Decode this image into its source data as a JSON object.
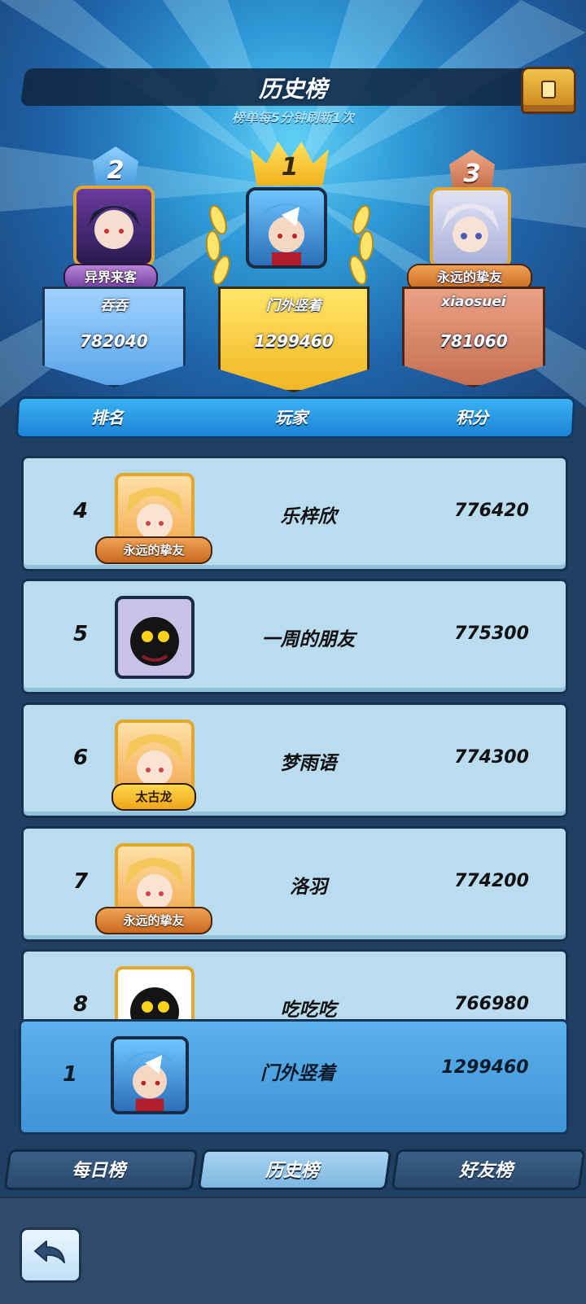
{
  "header": {
    "title": "历史榜",
    "subtitle": "榜单每5分钟刷新1次"
  },
  "podium": [
    {
      "rank": "1",
      "badge_title": "",
      "name": "门外竖着",
      "score": "1299460"
    },
    {
      "rank": "2",
      "badge_title": "异界来客",
      "name": "吞吞",
      "score": "782040"
    },
    {
      "rank": "3",
      "badge_title": "永远的挚友",
      "name": "xiaosuei",
      "score": "781060"
    }
  ],
  "table": {
    "columns": [
      "排名",
      "玩家",
      "积分"
    ],
    "rows": [
      {
        "rank": "4",
        "name": "乐梓欣",
        "score": "776420",
        "tag": "永远的挚友"
      },
      {
        "rank": "5",
        "name": "一周的朋友",
        "score": "775300",
        "tag": ""
      },
      {
        "rank": "6",
        "name": "梦雨语",
        "score": "774300",
        "tag": "太古龙"
      },
      {
        "rank": "7",
        "name": "洛羽",
        "score": "774200",
        "tag": "永远的挚友"
      },
      {
        "rank": "8",
        "name": "吃吃吃",
        "score": "766980",
        "tag": ""
      }
    ]
  },
  "self_row": {
    "rank": "1",
    "name": "门外竖着",
    "score": "1299460"
  },
  "tabs": [
    {
      "label": "每日榜",
      "active": false
    },
    {
      "label": "历史榜",
      "active": true
    },
    {
      "label": "好友榜",
      "active": false
    }
  ],
  "icons": {
    "chest": "treasure-chest-icon",
    "back": "back-arrow-icon",
    "crown": "crown-icon",
    "laurel": "laurel-icon"
  },
  "colors": {
    "gold": "#f5c52a",
    "silver": "#7db8ea",
    "bronze": "#d98b6b",
    "row_bg": "#b9dcef",
    "self_row_bg": "#4ea3e2"
  }
}
